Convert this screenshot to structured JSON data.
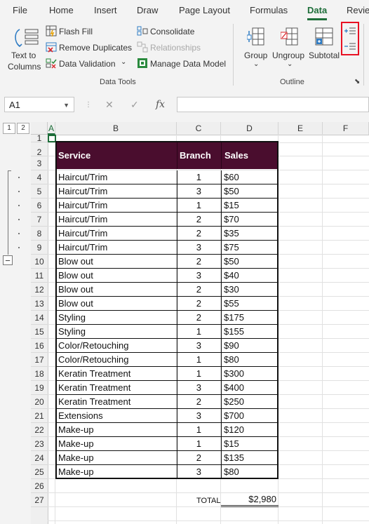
{
  "ribbon": {
    "tabs": [
      "File",
      "Home",
      "Insert",
      "Draw",
      "Page Layout",
      "Formulas",
      "Data",
      "Revie"
    ],
    "active_tab": "Data",
    "text_to_columns": [
      "Text to",
      "Columns"
    ],
    "flash_fill": "Flash Fill",
    "remove_duplicates": "Remove Duplicates",
    "data_validation": "Data Validation",
    "consolidate": "Consolidate",
    "relationships": "Relationships",
    "manage_data_model": "Manage Data Model",
    "data_tools_label": "Data Tools",
    "group": "Group",
    "ungroup": "Ungroup",
    "subtotal": "Subtotal",
    "outline_label": "Outline",
    "highlight_color": "#e81123"
  },
  "formula_bar": {
    "name_box": "A1",
    "fx": "fx",
    "cancel": "✕",
    "enter": "✓",
    "formula": ""
  },
  "outline": {
    "levels": [
      "1",
      "2"
    ],
    "collapse_symbol": "−"
  },
  "columns": [
    "A",
    "B",
    "C",
    "D",
    "E",
    "F"
  ],
  "rows": [
    "1",
    "2",
    "3",
    "4",
    "5",
    "6",
    "7",
    "8",
    "9",
    "10",
    "11",
    "12",
    "13",
    "14",
    "15",
    "16",
    "17",
    "18",
    "19",
    "20",
    "21",
    "22",
    "23",
    "24",
    "25",
    "26",
    "27"
  ],
  "table": {
    "headers": [
      "Service",
      "Branch",
      "Sales"
    ],
    "header_bg": "#4a0d2e",
    "rows": [
      [
        "Haircut/Trim",
        "1",
        "$60"
      ],
      [
        "Haircut/Trim",
        "3",
        "$50"
      ],
      [
        "Haircut/Trim",
        "1",
        "$15"
      ],
      [
        "Haircut/Trim",
        "2",
        "$70"
      ],
      [
        "Haircut/Trim",
        "2",
        "$35"
      ],
      [
        "Haircut/Trim",
        "3",
        "$75"
      ],
      [
        "Blow out",
        "2",
        "$50"
      ],
      [
        "Blow out",
        "3",
        "$40"
      ],
      [
        "Blow out",
        "2",
        "$30"
      ],
      [
        "Blow out",
        "2",
        "$55"
      ],
      [
        "Styling",
        "2",
        "$175"
      ],
      [
        "Styling",
        "1",
        "$155"
      ],
      [
        "Color/Retouching",
        "3",
        "$90"
      ],
      [
        "Color/Retouching",
        "1",
        "$80"
      ],
      [
        "Keratin Treatment",
        "1",
        "$300"
      ],
      [
        "Keratin Treatment",
        "3",
        "$400"
      ],
      [
        "Keratin Treatment",
        "2",
        "$250"
      ],
      [
        "Extensions",
        "3",
        "$700"
      ],
      [
        "Make-up",
        "1",
        "$120"
      ],
      [
        "Make-up",
        "1",
        "$15"
      ],
      [
        "Make-up",
        "2",
        "$135"
      ],
      [
        "Make-up",
        "3",
        "$80"
      ]
    ]
  },
  "total": {
    "label": "TOTAL",
    "value": "$2,980"
  }
}
